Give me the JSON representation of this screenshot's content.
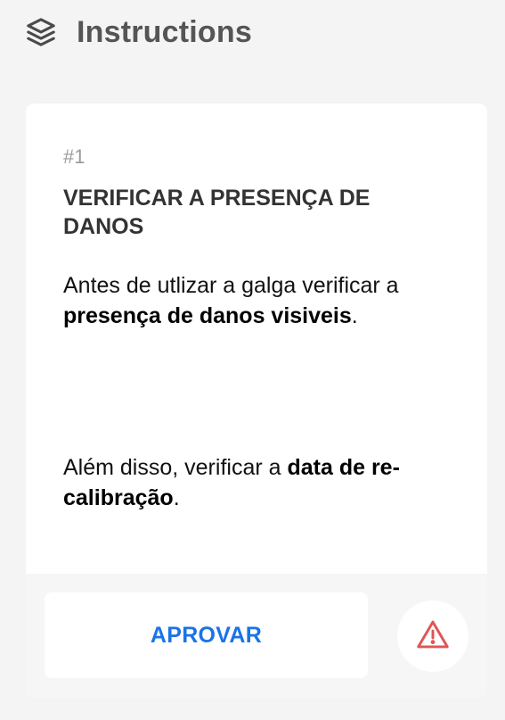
{
  "header": {
    "title": "Instructions",
    "icon": "layers-icon"
  },
  "instruction": {
    "number": "#1",
    "title": "VERIFICAR A PRESENÇA DE DANOS",
    "paragraph_1": {
      "text_before": "Antes de utlizar a galga verificar a ",
      "bold": "presença de danos visiveis",
      "text_after": "."
    },
    "paragraph_2": {
      "text_before": "Além disso, verificar a ",
      "bold": "data de re-calibração",
      "text_after": "."
    }
  },
  "actions": {
    "approve_label": "APROVAR",
    "warning_icon": "warning-icon"
  },
  "colors": {
    "accent": "#1a73e8",
    "warning": "#e05555",
    "title_gray": "#555555",
    "number_gray": "#9a9a9a"
  }
}
